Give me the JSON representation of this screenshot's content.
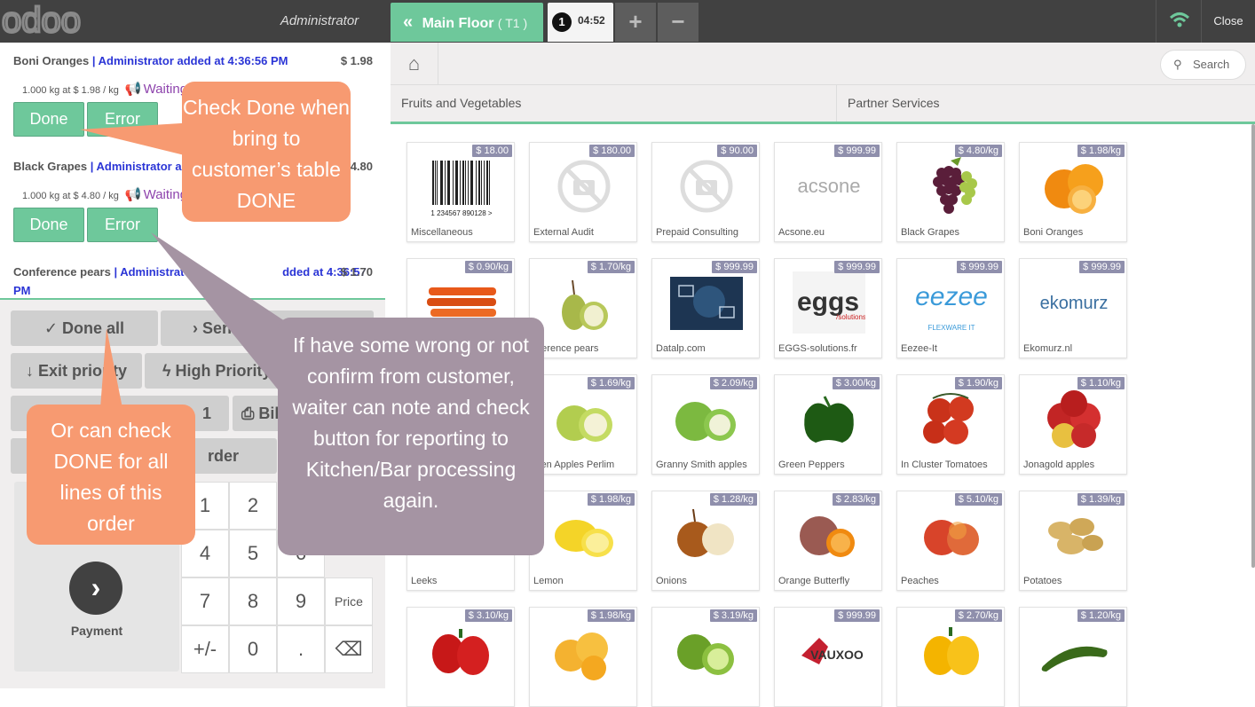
{
  "app": {
    "logo_text": "odoo",
    "cashier": "Administrator",
    "close": "Close"
  },
  "floor": {
    "name": "Main Floor",
    "table": "( T1 )"
  },
  "order_tab": {
    "number": "1",
    "time": "04:52"
  },
  "tab_buttons": {
    "add": "+",
    "remove": "−"
  },
  "order_lines": [
    {
      "name": "Boni Oranges",
      "note": "| Administrator added at 4:36:56 PM",
      "price": "$ 1.98",
      "qty": "1.000 kg at $ 1.98 / kg",
      "status": "Waiting"
    },
    {
      "name": "Black Grapes",
      "note": "| Administrator ad",
      "price": "4.80",
      "qty": "1.000 kg at $ 4.80 / kg",
      "status": "Waiting"
    },
    {
      "name": "Conference pears",
      "note": "| Administrator",
      "note2": "dded at 4:36:57",
      "note3": "PM",
      "price": "$ 1.70"
    }
  ],
  "line_buttons": {
    "done": "Done",
    "error": "Error"
  },
  "controls": {
    "done_all": "Done all",
    "send": "Send",
    "exit_priority": "Exit priority",
    "high_priority": "High Priority",
    "bill": "Bil",
    "frag1": "1",
    "order": "rder"
  },
  "payment": {
    "label": "Payment",
    "icon": "›"
  },
  "numpad": {
    "k1": "1",
    "k2": "2",
    "k4": "4",
    "k5": "5",
    "k6": "6",
    "k7": "7",
    "k8": "8",
    "k9": "9",
    "price": "Price",
    "plusminus": "+/-",
    "k0": "0",
    "dot": ".",
    "backspace": "⌫"
  },
  "search": {
    "placeholder": "Search"
  },
  "categories": [
    "Fruits and Vegetables",
    "Partner Services"
  ],
  "products": [
    {
      "name": "Miscellaneous",
      "price": "$ 18.00"
    },
    {
      "name": "External Audit",
      "price": "$ 180.00"
    },
    {
      "name": "Prepaid Consulting",
      "price": "$ 90.00"
    },
    {
      "name": "Acsone.eu",
      "price": "$ 999.99"
    },
    {
      "name": "Black Grapes",
      "price": "$ 4.80/kg"
    },
    {
      "name": "Boni Oranges",
      "price": "$ 1.98/kg"
    },
    {
      "name": "",
      "price": "$ 0.90/kg"
    },
    {
      "name": "nference pears",
      "price": "$ 1.70/kg"
    },
    {
      "name": "Datalp.com",
      "price": "$ 999.99"
    },
    {
      "name": "EGGS-solutions.fr",
      "price": "$ 999.99"
    },
    {
      "name": "Eezee-It",
      "price": "$ 999.99"
    },
    {
      "name": "Ekomurz.nl",
      "price": "$ 999.99"
    },
    {
      "name": "",
      "price": ""
    },
    {
      "name": "lden Apples Perlim",
      "price": "$ 1.69/kg"
    },
    {
      "name": "Granny Smith apples",
      "price": "$ 2.09/kg"
    },
    {
      "name": "Green Peppers",
      "price": "$ 3.00/kg"
    },
    {
      "name": "In Cluster Tomatoes",
      "price": "$ 1.90/kg"
    },
    {
      "name": "Jonagold apples",
      "price": "$ 1.10/kg"
    },
    {
      "name": "Leeks",
      "price": ""
    },
    {
      "name": "Lemon",
      "price": "$ 1.98/kg"
    },
    {
      "name": "Onions",
      "price": "$ 1.28/kg"
    },
    {
      "name": "Orange Butterfly",
      "price": "$ 2.83/kg"
    },
    {
      "name": "Peaches",
      "price": "$ 5.10/kg"
    },
    {
      "name": "Potatoes",
      "price": "$ 1.39/kg"
    },
    {
      "name": "",
      "price": "$ 3.10/kg"
    },
    {
      "name": "",
      "price": "$ 1.98/kg"
    },
    {
      "name": "",
      "price": "$ 3.19/kg"
    },
    {
      "name": "",
      "price": "$ 999.99"
    },
    {
      "name": "",
      "price": "$ 2.70/kg"
    },
    {
      "name": "",
      "price": "$ 1.20/kg"
    }
  ],
  "logos": {
    "acsone": "acsone",
    "eggs": "eggs",
    "eggs_sub": "/solutions",
    "eezee": "eezee",
    "eezee_sub": "FLEXWARE IT",
    "ekomurz": "ekomurz",
    "vauxoo": "VAUXOO",
    "barcode": "1 234567 890128 >"
  },
  "callouts": {
    "done": "Check Done when bring to customer’s table DONE",
    "error": "If have some wrong or not confirm from customer, waiter can note and check button for reporting to Kitchen/Bar processing again.",
    "done_all": "Or can check DONE for all lines of this order"
  },
  "colors": {
    "accent": "#6ec89b",
    "topbar": "#414141",
    "callout_orange": "#f79a71",
    "callout_purple": "#a594a3",
    "price_tag": "#8f8fac",
    "note_blue": "#2b35d6",
    "waiting_purple": "#8e44ad"
  }
}
